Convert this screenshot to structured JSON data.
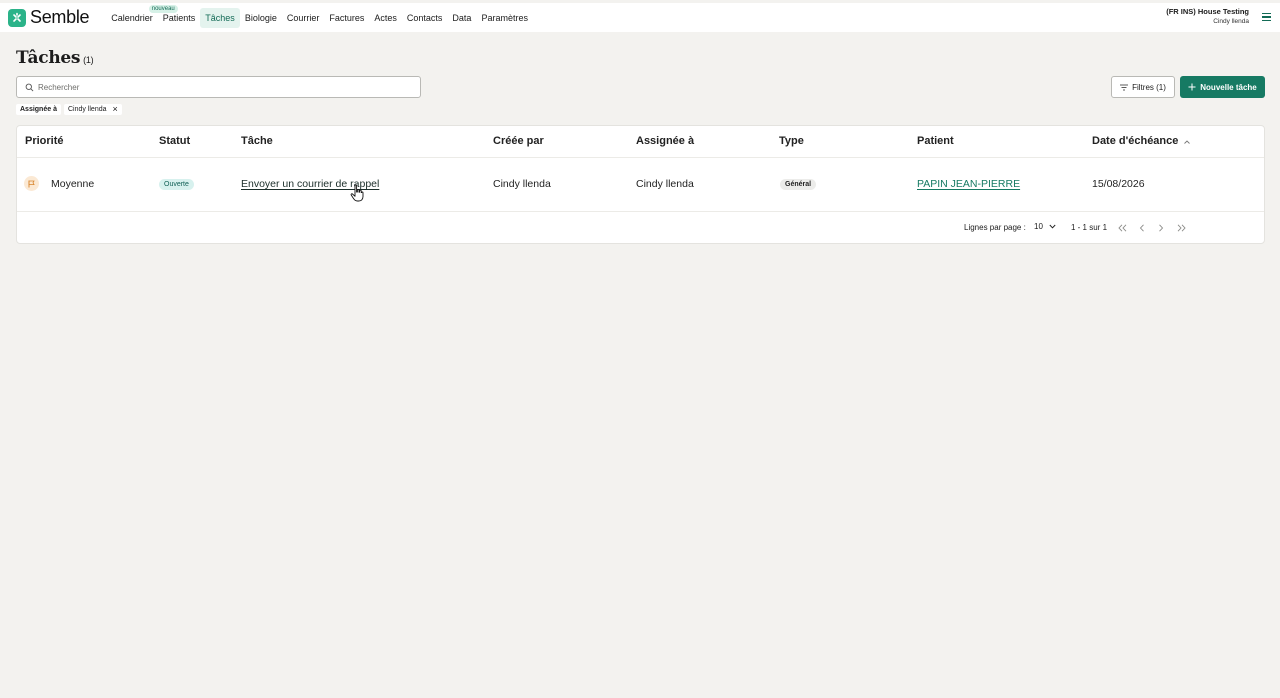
{
  "app": {
    "name": "Semble",
    "brand_color": "#2bb389",
    "accent_color": "#167a63"
  },
  "nav": {
    "items": [
      {
        "label": "Calendrier",
        "badge": "nouveau"
      },
      {
        "label": "Patients"
      },
      {
        "label": "Tâches",
        "active": true
      },
      {
        "label": "Biologie"
      },
      {
        "label": "Courrier"
      },
      {
        "label": "Factures"
      },
      {
        "label": "Actes"
      },
      {
        "label": "Contacts"
      },
      {
        "label": "Data"
      },
      {
        "label": "Paramètres"
      }
    ]
  },
  "account": {
    "org": "(FR INS) House Testing",
    "user": "Cindy llenda",
    "menu_icon": "hamburger-icon"
  },
  "page": {
    "title": "Tâches",
    "count": "(1)"
  },
  "search": {
    "placeholder": "Rechercher",
    "value": "",
    "icon": "search-icon"
  },
  "toolbar": {
    "filter_label": "Filtres (1)",
    "new_task_label": "Nouvelle tâche"
  },
  "active_filter": {
    "label": "Assignée à",
    "value": "Cindy llenda"
  },
  "table": {
    "columns": [
      "Priorité",
      "Statut",
      "Tâche",
      "Créée par",
      "Assignée à",
      "Type",
      "Patient",
      "Date d'échéance"
    ],
    "sorted_column": "Date d'échéance",
    "sort_direction": "ascending",
    "rows": [
      {
        "priority": "Moyenne",
        "priority_icon": "flag-icon",
        "status": "Ouverte",
        "task": "Envoyer un courrier de rappel",
        "created_by": "Cindy llenda",
        "assigned_to": "Cindy llenda",
        "type": "Général",
        "patient": "PAPIN JEAN-PIERRE",
        "due_date": "15/08/2026"
      }
    ]
  },
  "pagination": {
    "rows_per_page_label": "Lignes par page :",
    "rows_per_page": "10",
    "range": "1 - 1 sur 1"
  }
}
